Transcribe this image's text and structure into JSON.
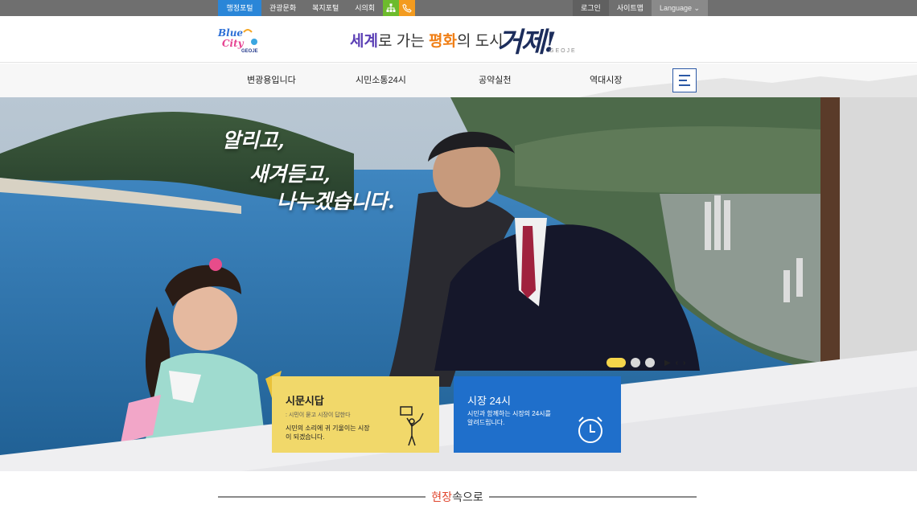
{
  "topbar": {
    "left_links": [
      "행정포털",
      "관광문화",
      "복지포털",
      "시의회"
    ],
    "right_links": [
      "로그인",
      "사이트맵"
    ],
    "language": "Language",
    "icons": [
      "sitemap-icon",
      "phone-icon"
    ]
  },
  "header": {
    "logo_text": "Blue City GEOJE",
    "slogan_part1": "세계",
    "slogan_part2": "로 가는 ",
    "slogan_part3": "평화",
    "slogan_part4": "의 도시",
    "city_script": "거제!",
    "city_small": "GEOJE"
  },
  "nav": {
    "items": [
      "변광용입니다",
      "시민소통24시",
      "공약실천",
      "역대시장"
    ]
  },
  "hero": {
    "line1": "알리고,",
    "line2": "새겨듣고,",
    "line3": "나누겠습니다."
  },
  "cards": {
    "left": {
      "title": "시문시답",
      "sub": ": 시민이 묻고 시장이 답한다",
      "desc": "시민의 소리에 귀 기울이는 시장이 되겠습니다."
    },
    "right": {
      "title": "시장 24시",
      "desc": "시민과 함께하는 시장의 24시를 알려드립니다."
    }
  },
  "pager": {
    "count": 3,
    "active": 1
  },
  "section": {
    "title_red": "현장",
    "title_rest": "속으로"
  },
  "colors": {
    "active_top": "#2a86d8",
    "green": "#6dbb2d",
    "orange": "#f39b1f",
    "card_yellow": "#f1d86a",
    "card_blue": "#1f6fcb",
    "accent_red": "#e0442c"
  }
}
